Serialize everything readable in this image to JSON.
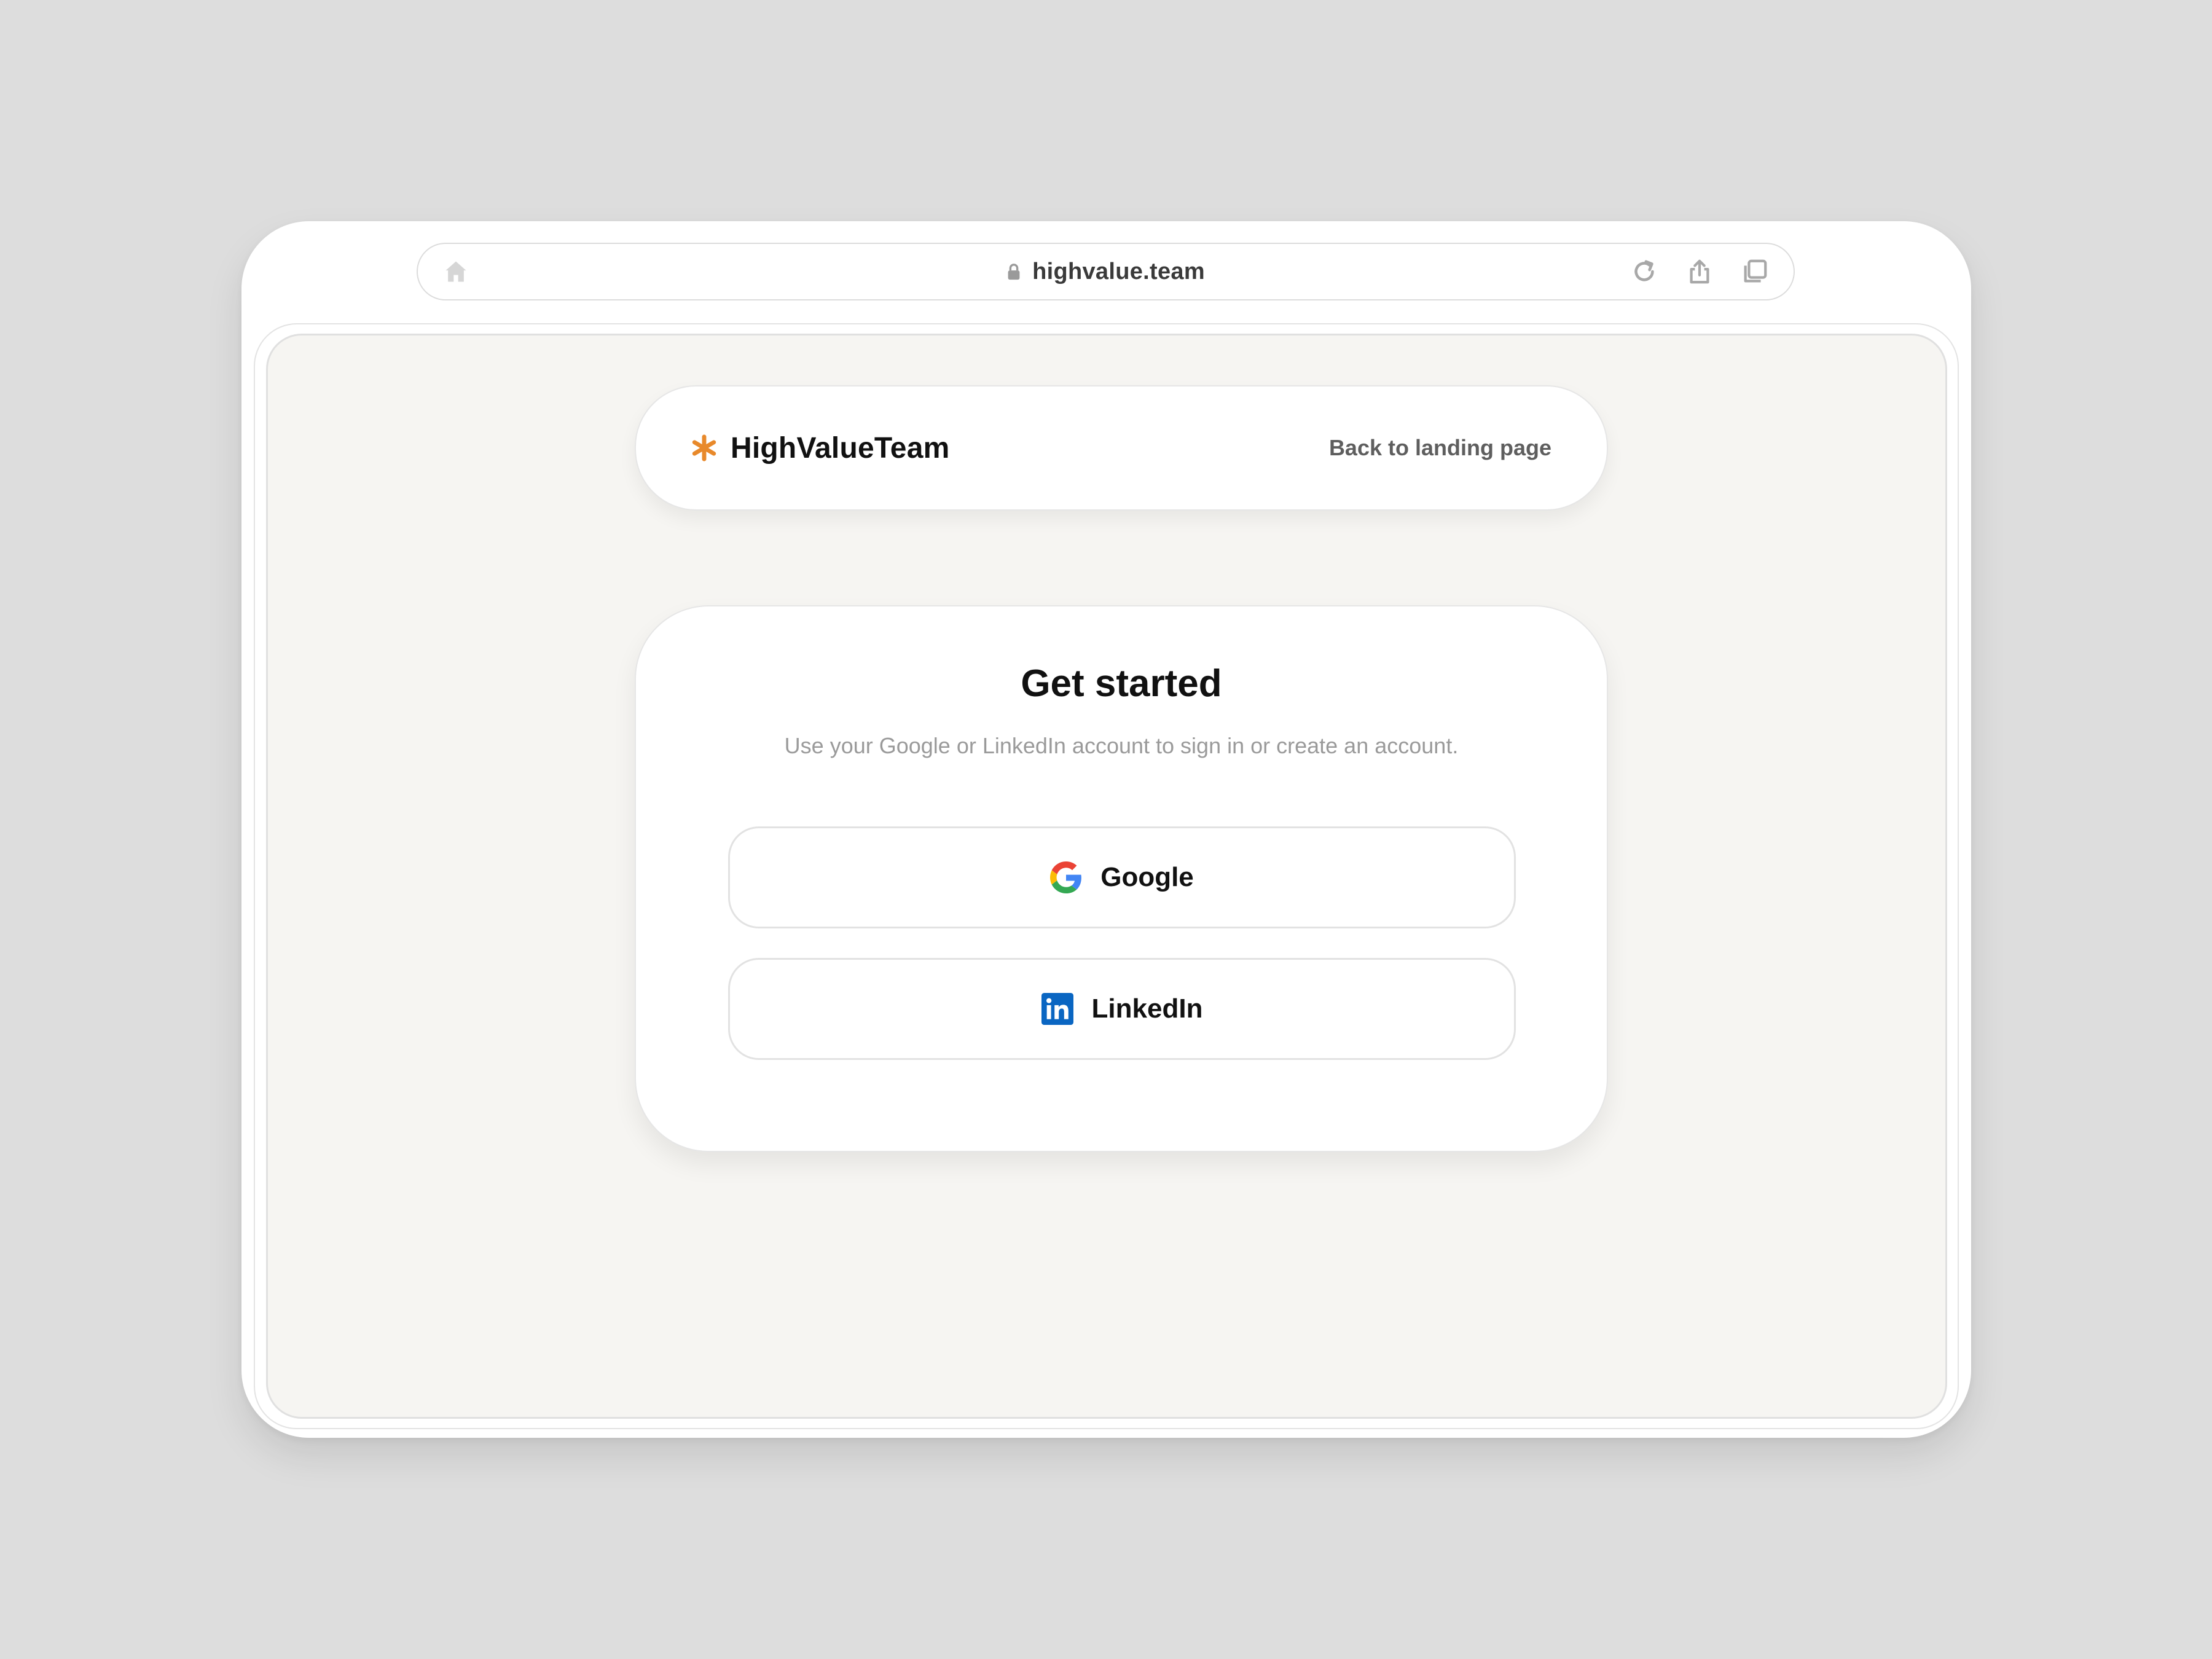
{
  "browser": {
    "url": "highvalue.team",
    "icons": [
      "home-icon",
      "lock-icon",
      "reload-icon",
      "share-icon",
      "tabs-icon"
    ]
  },
  "nav": {
    "brand": "HighValueTeam",
    "back_link": "Back to landing page",
    "brand_icon": "asterisk-icon",
    "brand_color": "#e8892b"
  },
  "auth": {
    "title": "Get started",
    "subtitle": "Use your Google or LinkedIn account to sign in or create an account.",
    "buttons": [
      {
        "label": "Google",
        "icon": "google-icon"
      },
      {
        "label": "LinkedIn",
        "icon": "linkedin-icon",
        "color": "#0a66c2"
      }
    ]
  }
}
